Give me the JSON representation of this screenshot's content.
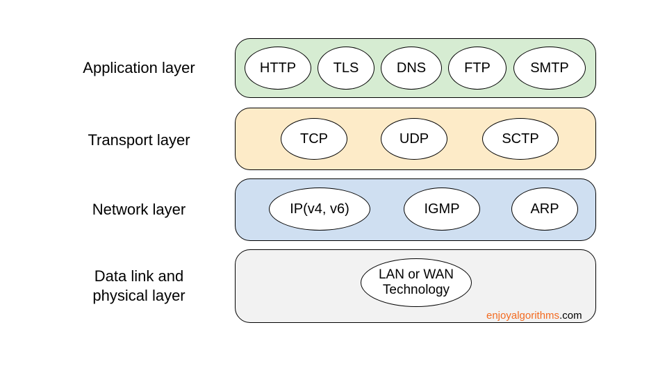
{
  "layers": [
    {
      "label": "Application layer",
      "color": "#d6ecd2",
      "protocols": [
        "HTTP",
        "TLS",
        "DNS",
        "FTP",
        "SMTP"
      ]
    },
    {
      "label": "Transport layer",
      "color": "#fdebc8",
      "protocols": [
        "TCP",
        "UDP",
        "SCTP"
      ]
    },
    {
      "label": "Network layer",
      "color": "#cfdff1",
      "protocols": [
        "IP(v4, v6)",
        "IGMP",
        "ARP"
      ]
    },
    {
      "label": "Data link and\nphysical layer",
      "color": "#f2f2f2",
      "protocols": [
        "LAN or WAN\nTechnology"
      ]
    }
  ],
  "credit": {
    "brand": "enjoyalgorithms",
    "suffix": ".com"
  }
}
